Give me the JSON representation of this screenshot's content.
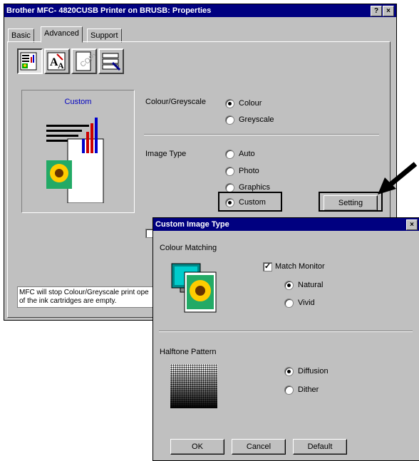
{
  "main_window": {
    "title": "Brother MFC- 4820CUSB Printer on BRUSB: Properties",
    "help_glyph": "?",
    "close_glyph": "×",
    "tabs": [
      {
        "label": "Basic"
      },
      {
        "label": "Advanced",
        "active": true
      },
      {
        "label": "Support"
      }
    ],
    "preview_label": "Custom",
    "colour_greyscale": {
      "label": "Colour/Greyscale",
      "options": [
        {
          "label": "Colour",
          "selected": true
        },
        {
          "label": "Greyscale",
          "selected": false
        }
      ]
    },
    "image_type": {
      "label": "Image Type",
      "options": [
        {
          "label": "Auto",
          "selected": false
        },
        {
          "label": "Photo",
          "selected": false
        },
        {
          "label": "Graphics",
          "selected": false
        },
        {
          "label": "Custom",
          "selected": true
        }
      ],
      "setting_button": "Setting"
    },
    "status_text_line1": "MFC will stop Colour/Greyscale print ope",
    "status_text_line2": "of the ink cartridges are empty."
  },
  "dialog": {
    "title": "Custom Image Type",
    "close_glyph": "×",
    "colour_matching": {
      "label": "Colour Matching",
      "match_monitor": {
        "label": "Match Monitor",
        "checked": true
      },
      "options": [
        {
          "label": "Natural",
          "selected": true
        },
        {
          "label": "Vivid",
          "selected": false
        }
      ]
    },
    "halftone": {
      "label": "Halftone Pattern",
      "options": [
        {
          "label": "Diffusion",
          "selected": true
        },
        {
          "label": "Dither",
          "selected": false
        }
      ]
    },
    "buttons": {
      "ok": "OK",
      "cancel": "Cancel",
      "default": "Default"
    }
  },
  "colors": {
    "title_bar": "#000080",
    "face": "#c0c0c0",
    "preview_text": "#0000c0"
  },
  "icons": [
    "print-quality-icon",
    "font-icon",
    "watermark-icon",
    "device-options-icon",
    "arrow-pointer-icon",
    "monitor-sunflower-icon",
    "halftone-dots-icon",
    "sunflower-page-icon"
  ]
}
